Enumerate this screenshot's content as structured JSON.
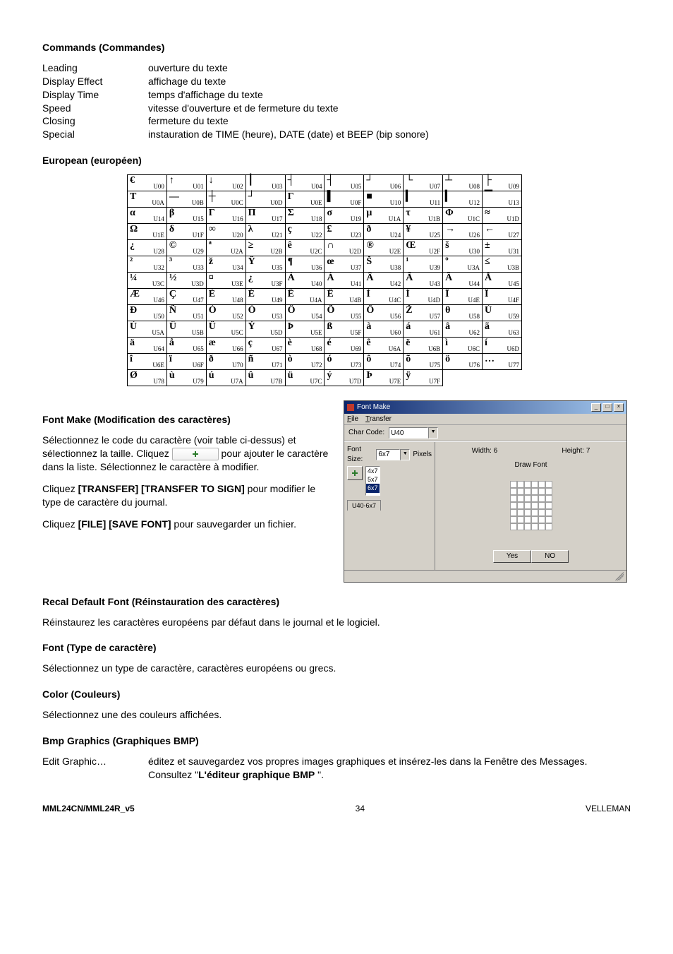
{
  "headings": {
    "commands": "Commands (Commandes)",
    "european": "European (européen)",
    "fontmake": "Font Make (Modification des caractères)",
    "recal": "Recal Default Font (Réinstauration des caractères)",
    "font": "Font (Type de caractère)",
    "color": "Color (Couleurs)",
    "bmp": "Bmp Graphics (Graphiques BMP)"
  },
  "commands": {
    "rows": [
      {
        "term": "Leading",
        "def": "ouverture du texte"
      },
      {
        "term": "Display Effect",
        "def": "affichage du texte"
      },
      {
        "term": "Display Time",
        "def": "temps d'affichage du texte"
      },
      {
        "term": "Speed",
        "def": "vitesse d'ouverture et de fermeture du texte"
      },
      {
        "term": "Closing",
        "def": "fermeture du texte"
      },
      {
        "term": "Special",
        "def": "instauration de TIME (heure), DATE (date) et BEEP (bip sonore)"
      }
    ]
  },
  "char_table": [
    [
      {
        "g": "€",
        "c": "U00"
      },
      {
        "g": "↑",
        "c": "U01"
      },
      {
        "g": "↓",
        "c": "U02"
      },
      {
        "g": "⎮",
        "c": "U03"
      },
      {
        "g": "┤",
        "c": "U04"
      },
      {
        "g": "┤",
        "c": "U05"
      },
      {
        "g": "┘",
        "c": "U06"
      },
      {
        "g": "└",
        "c": "U07"
      },
      {
        "g": "┴",
        "c": "U08"
      },
      {
        "g": "├",
        "c": "U09"
      }
    ],
    [
      {
        "g": "T",
        "c": "U0A"
      },
      {
        "g": "—",
        "c": "U0B"
      },
      {
        "g": "┼",
        "c": "U0C"
      },
      {
        "g": "┘",
        "c": "U0D"
      },
      {
        "g": "Γ",
        "c": "U0E"
      },
      {
        "g": "▌",
        "c": "U0F"
      },
      {
        "g": "■",
        "c": "U10"
      },
      {
        "g": "▎",
        "c": "U11"
      },
      {
        "g": "▎",
        "c": "U12"
      },
      {
        "g": "▔",
        "c": "U13"
      }
    ],
    [
      {
        "g": "α",
        "c": "U14"
      },
      {
        "g": "β",
        "c": "U15"
      },
      {
        "g": "Γ",
        "c": "U16"
      },
      {
        "g": "Π",
        "c": "U17"
      },
      {
        "g": "Σ",
        "c": "U18"
      },
      {
        "g": "σ",
        "c": "U19"
      },
      {
        "g": "μ",
        "c": "U1A"
      },
      {
        "g": "τ",
        "c": "U1B"
      },
      {
        "g": "Φ",
        "c": "U1C"
      },
      {
        "g": "≈",
        "c": "U1D"
      }
    ],
    [
      {
        "g": "Ω",
        "c": "U1E"
      },
      {
        "g": "δ",
        "c": "U1F"
      },
      {
        "g": "∞",
        "c": "U20"
      },
      {
        "g": "λ",
        "c": "U21"
      },
      {
        "g": "ç",
        "c": "U22"
      },
      {
        "g": "£",
        "c": "U23"
      },
      {
        "g": "ð",
        "c": "U24"
      },
      {
        "g": "¥",
        "c": "U25"
      },
      {
        "g": "→",
        "c": "U26"
      },
      {
        "g": "←",
        "c": "U27"
      }
    ],
    [
      {
        "g": "¿",
        "c": "U28"
      },
      {
        "g": "©",
        "c": "U29"
      },
      {
        "g": "ª",
        "c": "U2A"
      },
      {
        "g": "≥",
        "c": "U2B"
      },
      {
        "g": "ê",
        "c": "U2C"
      },
      {
        "g": "∩",
        "c": "U2D"
      },
      {
        "g": "®",
        "c": "U2E"
      },
      {
        "g": "Œ",
        "c": "U2F"
      },
      {
        "g": "š",
        "c": "U30"
      },
      {
        "g": "±",
        "c": "U31"
      }
    ],
    [
      {
        "g": "²",
        "c": "U32"
      },
      {
        "g": "³",
        "c": "U33"
      },
      {
        "g": "ž",
        "c": "U34"
      },
      {
        "g": "Ÿ",
        "c": "U35"
      },
      {
        "g": "¶",
        "c": "U36"
      },
      {
        "g": "œ",
        "c": "U37"
      },
      {
        "g": "Š",
        "c": "U38"
      },
      {
        "g": "¹",
        "c": "U39"
      },
      {
        "g": "º",
        "c": "U3A"
      },
      {
        "g": "≤",
        "c": "U3B"
      }
    ],
    [
      {
        "g": "¼",
        "c": "U3C"
      },
      {
        "g": "½",
        "c": "U3D"
      },
      {
        "g": "¤",
        "c": "U3E"
      },
      {
        "g": "¿",
        "c": "U3F"
      },
      {
        "g": "À",
        "c": "U40"
      },
      {
        "g": "Á",
        "c": "U41"
      },
      {
        "g": "Â",
        "c": "U42"
      },
      {
        "g": "Ã",
        "c": "U43"
      },
      {
        "g": "Ä",
        "c": "U44"
      },
      {
        "g": "Å",
        "c": "U45"
      }
    ],
    [
      {
        "g": "Æ",
        "c": "U46"
      },
      {
        "g": "Ç",
        "c": "U47"
      },
      {
        "g": "È",
        "c": "U48"
      },
      {
        "g": "É",
        "c": "U49"
      },
      {
        "g": "Ê",
        "c": "U4A"
      },
      {
        "g": "Ë",
        "c": "U4B"
      },
      {
        "g": "Ì",
        "c": "U4C"
      },
      {
        "g": "Í",
        "c": "U4D"
      },
      {
        "g": "Î",
        "c": "U4E"
      },
      {
        "g": "Ï",
        "c": "U4F"
      }
    ],
    [
      {
        "g": "Ð",
        "c": "U50"
      },
      {
        "g": "Ñ",
        "c": "U51"
      },
      {
        "g": "Ò",
        "c": "U52"
      },
      {
        "g": "Ó",
        "c": "U53"
      },
      {
        "g": "Ô",
        "c": "U54"
      },
      {
        "g": "Õ",
        "c": "U55"
      },
      {
        "g": "Ö",
        "c": "U56"
      },
      {
        "g": "Ž",
        "c": "U57"
      },
      {
        "g": "θ",
        "c": "U58"
      },
      {
        "g": "Ù",
        "c": "U59"
      }
    ],
    [
      {
        "g": "Ú",
        "c": "U5A"
      },
      {
        "g": "Û",
        "c": "U5B"
      },
      {
        "g": "Ü",
        "c": "U5C"
      },
      {
        "g": "Ý",
        "c": "U5D"
      },
      {
        "g": "Þ",
        "c": "U5E"
      },
      {
        "g": "ß",
        "c": "U5F"
      },
      {
        "g": "à",
        "c": "U60"
      },
      {
        "g": "á",
        "c": "U61"
      },
      {
        "g": "â",
        "c": "U62"
      },
      {
        "g": "ã",
        "c": "U63"
      }
    ],
    [
      {
        "g": "ä",
        "c": "U64"
      },
      {
        "g": "å",
        "c": "U65"
      },
      {
        "g": "æ",
        "c": "U66"
      },
      {
        "g": "ç",
        "c": "U67"
      },
      {
        "g": "è",
        "c": "U68"
      },
      {
        "g": "é",
        "c": "U69"
      },
      {
        "g": "ê",
        "c": "U6A"
      },
      {
        "g": "ë",
        "c": "U6B"
      },
      {
        "g": "ì",
        "c": "U6C"
      },
      {
        "g": "í",
        "c": "U6D"
      }
    ],
    [
      {
        "g": "î",
        "c": "U6E"
      },
      {
        "g": "ï",
        "c": "U6F"
      },
      {
        "g": "ð",
        "c": "U70"
      },
      {
        "g": "ñ",
        "c": "U71"
      },
      {
        "g": "ò",
        "c": "U72"
      },
      {
        "g": "ó",
        "c": "U73"
      },
      {
        "g": "ô",
        "c": "U74"
      },
      {
        "g": "õ",
        "c": "U75"
      },
      {
        "g": "ö",
        "c": "U76"
      },
      {
        "g": "…",
        "c": "U77"
      }
    ],
    [
      {
        "g": "Ø",
        "c": "U78"
      },
      {
        "g": "ù",
        "c": "U79"
      },
      {
        "g": "ú",
        "c": "U7A"
      },
      {
        "g": "û",
        "c": "U7B"
      },
      {
        "g": "ü",
        "c": "U7C"
      },
      {
        "g": "ý",
        "c": "U7D"
      },
      {
        "g": "Þ",
        "c": "U7E"
      },
      {
        "g": "ÿ",
        "c": "U7F"
      },
      null,
      null
    ]
  ],
  "font_make_text": {
    "p1a": "Sélectionnez le code du caractère (voir table ci-dessus) et sélectionnez la taille. Cliquez ",
    "p1b": " pour ajouter le caractère dans la liste. Sélectionnez le caractère à modifier.",
    "p2a": "Cliquez ",
    "p2b": "[TRANSFER] [TRANSFER TO SIGN]",
    "p2c": " pour modifier le type de caractère du journal.",
    "p3a": "Cliquez ",
    "p3b": "[FILE] [SAVE FONT]",
    "p3c": " pour sauvegarder un fichier."
  },
  "recal_text": "Réinstaurez les caractères européens par défaut dans le journal et le logiciel.",
  "font_text": "Sélectionnez un type de caractère, caractères européens ou grecs.",
  "color_text": "Sélectionnez une des couleurs affichées.",
  "bmp": {
    "term": "Edit Graphic…",
    "def_a": "éditez et sauvegardez vos propres images graphiques et insérez-les dans la Fenêtre des Messages. Consultez \"",
    "def_b": "L'éditeur graphique BMP",
    "def_c": " \"."
  },
  "dialog": {
    "title": "Font Make",
    "menu": {
      "file": "File",
      "transfer": "Transfer"
    },
    "charcode_label": "Char Code:",
    "charcode_value": "U40",
    "fontsize_label": "Font Size:",
    "fontsize_value": "6x7",
    "pixels_label": "Pixels",
    "list": [
      "4x7",
      "5x7",
      "6x7"
    ],
    "tab": "U40-6x7",
    "width_label": "Width: 6",
    "height_label": "Height: 7",
    "drawfont": "Draw Font",
    "yes": "Yes",
    "no": "NO"
  },
  "footer": {
    "left": "MML24CN/MML24R_v5",
    "center": "34",
    "right": "VELLEMAN"
  }
}
